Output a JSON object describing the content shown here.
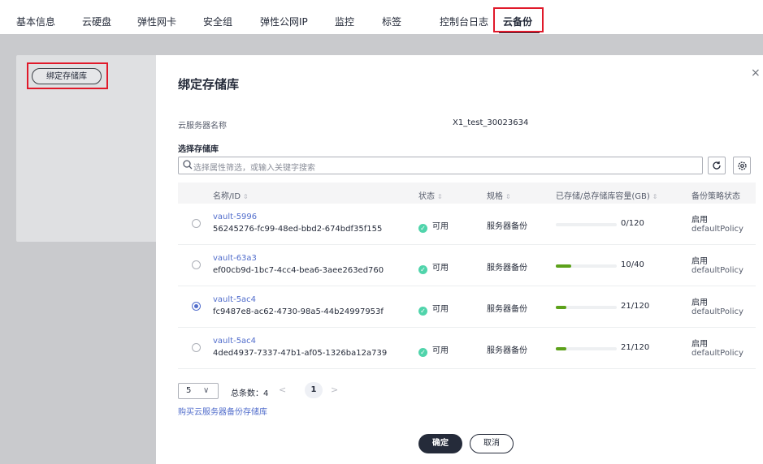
{
  "tabs": [
    {
      "label": "基本信息"
    },
    {
      "label": "云硬盘"
    },
    {
      "label": "弹性网卡"
    },
    {
      "label": "安全组"
    },
    {
      "label": "弹性公网IP"
    },
    {
      "label": "监控"
    },
    {
      "label": "标签"
    },
    {
      "label": "控制台日志"
    },
    {
      "label": "云备份"
    }
  ],
  "bind_button_label": "绑定存储库",
  "dialog": {
    "title": "绑定存储库",
    "close_glyph": "×",
    "server_name_label": "云服务器名称",
    "server_name_value": "X1_test_30023634",
    "select_vault_label": "选择存储库",
    "search_placeholder": "选择属性筛选，或输入关键字搜索",
    "table": {
      "headers": {
        "name": "名称/ID",
        "status": "状态",
        "spec": "规格",
        "capacity": "已存储/总存储库容量(GB)",
        "policy": "备份策略状态"
      },
      "rows": [
        {
          "name": "vault-5996",
          "id": "56245276-fc99-48ed-bbd2-674bdf35f155",
          "status": "可用",
          "spec": "服务器备份",
          "capacity": "0/120",
          "usage": 0.0,
          "policy_state": "启用",
          "policy_name": "defaultPolicy",
          "selected": false
        },
        {
          "name": "vault-63a3",
          "id": "ef00cb9d-1bc7-4cc4-bea6-3aee263ed760",
          "status": "可用",
          "spec": "服务器备份",
          "capacity": "10/40",
          "usage": 0.25,
          "policy_state": "启用",
          "policy_name": "defaultPolicy",
          "selected": false
        },
        {
          "name": "vault-5ac4",
          "id": "fc9487e8-ac62-4730-98a5-44b24997953f",
          "status": "可用",
          "spec": "服务器备份",
          "capacity": "21/120",
          "usage": 0.175,
          "policy_state": "启用",
          "policy_name": "defaultPolicy",
          "selected": true
        },
        {
          "name": "vault-5ac4",
          "id": "4ded4937-7337-47b1-af05-1326ba12a739",
          "status": "可用",
          "spec": "服务器备份",
          "capacity": "21/120",
          "usage": 0.175,
          "policy_state": "启用",
          "policy_name": "defaultPolicy",
          "selected": false
        }
      ]
    },
    "pagination": {
      "page_size": "5",
      "total_text": "总条数：4",
      "current_page": "1",
      "prev_glyph": "<",
      "next_glyph": ">"
    },
    "buy_link": "购买云服务器备份存储库",
    "ok_label": "确定",
    "cancel_label": "取消"
  },
  "colors": {
    "accent_link": "#526ecc",
    "progress_fill": "#5ca11a",
    "status_ok": "#50d4ab",
    "highlight_box": "#e0192a",
    "primary_button": "#252b3a"
  }
}
